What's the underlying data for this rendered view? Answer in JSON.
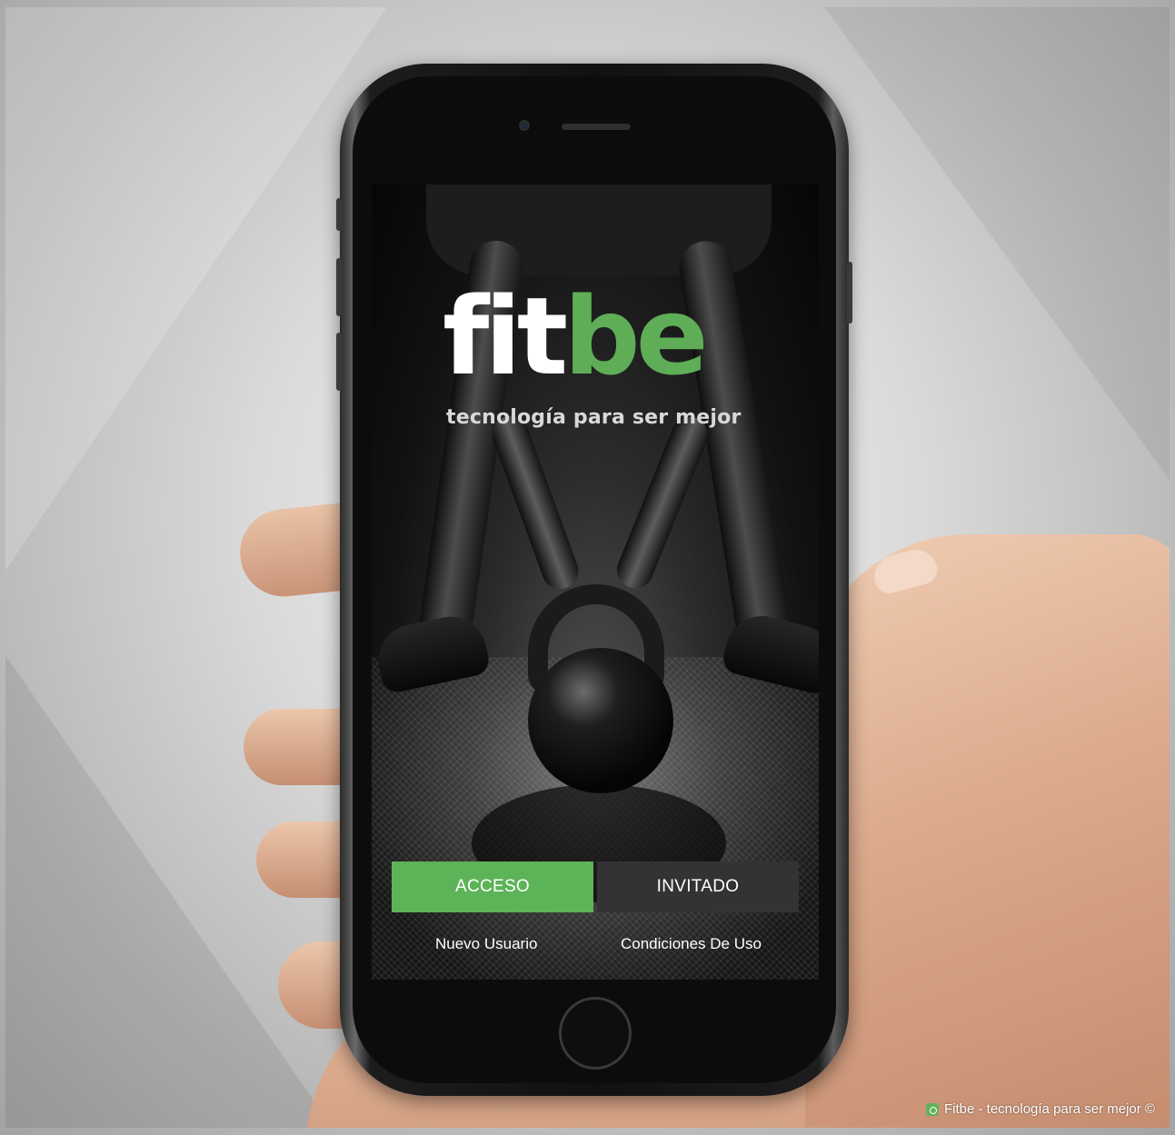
{
  "brand": {
    "logo_part_white": "fit",
    "logo_part_green": "be",
    "tagline": "tecnología para ser mejor",
    "accent_color": "#5db357"
  },
  "actions": {
    "login_label": "ACCESO",
    "guest_label": "INVITADO"
  },
  "links": {
    "new_user": "Nuevo Usuario",
    "terms": "Condiciones De Uso"
  },
  "watermark": {
    "icon": "fitbe-logo-icon",
    "text": "Fitbe - tecnología para ser mejor ©"
  }
}
